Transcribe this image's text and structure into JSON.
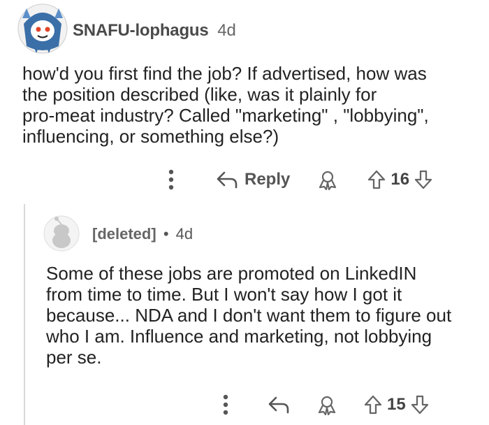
{
  "parent_comment": {
    "author": "SNAFU-lophagus",
    "time": "4d",
    "body": "how'd you first find the job? If advertised, how was\nthe position described (like, was it plainly for\npro-meat industry? Called \"marketing\" , \"lobbying\",\ninfluencing, or something else?)",
    "actions": {
      "reply_label": "Reply",
      "score": "16"
    }
  },
  "reply_comment": {
    "author": "[deleted]",
    "separator": "•",
    "time": "4d",
    "body": "Some of these jobs are promoted on LinkedIN\nfrom time to time. But I won't say how I got it\nbecause... NDA and I don't want them to figure out\nwho I am. Influence and marketing, not lobbying\nper se.",
    "actions": {
      "score": "15"
    }
  },
  "icons": {
    "more": "more-options-icon",
    "reply": "reply-arrow-icon",
    "award": "award-icon",
    "upvote": "upvote-arrow-icon",
    "downvote": "downvote-arrow-icon"
  },
  "colors": {
    "icon": "#666666",
    "thread_line": "#d8d8d8"
  }
}
